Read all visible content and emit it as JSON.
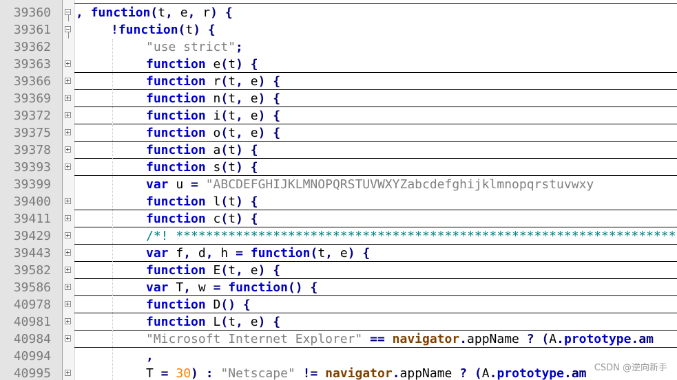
{
  "lines": [
    {
      "num": "39360",
      "fold": "minus",
      "indent": 0,
      "sep": false,
      "tokens": [
        {
          "t": "op",
          "v": ", "
        },
        {
          "t": "kw",
          "v": "function"
        },
        {
          "t": "op",
          "v": "("
        },
        {
          "t": "id",
          "v": "t"
        },
        {
          "t": "op",
          "v": ", "
        },
        {
          "t": "id",
          "v": "e"
        },
        {
          "t": "op",
          "v": ", "
        },
        {
          "t": "id",
          "v": "r"
        },
        {
          "t": "op",
          "v": ") {"
        }
      ]
    },
    {
      "num": "39361",
      "fold": "minus",
      "indent": 1,
      "sep": false,
      "tokens": [
        {
          "t": "op",
          "v": "!"
        },
        {
          "t": "kw",
          "v": "function"
        },
        {
          "t": "op",
          "v": "("
        },
        {
          "t": "id",
          "v": "t"
        },
        {
          "t": "op",
          "v": ") {"
        }
      ]
    },
    {
      "num": "39362",
      "fold": "none",
      "indent": 2,
      "sep": false,
      "tokens": [
        {
          "t": "str",
          "v": "\"use strict\""
        },
        {
          "t": "op",
          "v": ";"
        }
      ]
    },
    {
      "num": "39363",
      "fold": "plus",
      "indent": 2,
      "sep": true,
      "tokens": [
        {
          "t": "kw",
          "v": "function"
        },
        {
          "t": "op",
          "v": " "
        },
        {
          "t": "id",
          "v": "e"
        },
        {
          "t": "op",
          "v": "("
        },
        {
          "t": "id",
          "v": "t"
        },
        {
          "t": "op",
          "v": ") {"
        }
      ]
    },
    {
      "num": "39366",
      "fold": "plus",
      "indent": 2,
      "sep": true,
      "tokens": [
        {
          "t": "kw",
          "v": "function"
        },
        {
          "t": "op",
          "v": " "
        },
        {
          "t": "id",
          "v": "r"
        },
        {
          "t": "op",
          "v": "("
        },
        {
          "t": "id",
          "v": "t"
        },
        {
          "t": "op",
          "v": ", "
        },
        {
          "t": "id",
          "v": "e"
        },
        {
          "t": "op",
          "v": ") {"
        }
      ]
    },
    {
      "num": "39369",
      "fold": "plus",
      "indent": 2,
      "sep": true,
      "tokens": [
        {
          "t": "kw",
          "v": "function"
        },
        {
          "t": "op",
          "v": " "
        },
        {
          "t": "id",
          "v": "n"
        },
        {
          "t": "op",
          "v": "("
        },
        {
          "t": "id",
          "v": "t"
        },
        {
          "t": "op",
          "v": ", "
        },
        {
          "t": "id",
          "v": "e"
        },
        {
          "t": "op",
          "v": ") {"
        }
      ]
    },
    {
      "num": "39372",
      "fold": "plus",
      "indent": 2,
      "sep": true,
      "tokens": [
        {
          "t": "kw",
          "v": "function"
        },
        {
          "t": "op",
          "v": " "
        },
        {
          "t": "id",
          "v": "i"
        },
        {
          "t": "op",
          "v": "("
        },
        {
          "t": "id",
          "v": "t"
        },
        {
          "t": "op",
          "v": ", "
        },
        {
          "t": "id",
          "v": "e"
        },
        {
          "t": "op",
          "v": ") {"
        }
      ]
    },
    {
      "num": "39375",
      "fold": "plus",
      "indent": 2,
      "sep": true,
      "tokens": [
        {
          "t": "kw",
          "v": "function"
        },
        {
          "t": "op",
          "v": " "
        },
        {
          "t": "id",
          "v": "o"
        },
        {
          "t": "op",
          "v": "("
        },
        {
          "t": "id",
          "v": "t"
        },
        {
          "t": "op",
          "v": ", "
        },
        {
          "t": "id",
          "v": "e"
        },
        {
          "t": "op",
          "v": ") {"
        }
      ]
    },
    {
      "num": "39378",
      "fold": "plus",
      "indent": 2,
      "sep": true,
      "tokens": [
        {
          "t": "kw",
          "v": "function"
        },
        {
          "t": "op",
          "v": " "
        },
        {
          "t": "id",
          "v": "a"
        },
        {
          "t": "op",
          "v": "("
        },
        {
          "t": "id",
          "v": "t"
        },
        {
          "t": "op",
          "v": ") {"
        }
      ]
    },
    {
      "num": "39393",
      "fold": "plus",
      "indent": 2,
      "sep": true,
      "tokens": [
        {
          "t": "kw",
          "v": "function"
        },
        {
          "t": "op",
          "v": " "
        },
        {
          "t": "id",
          "v": "s"
        },
        {
          "t": "op",
          "v": "("
        },
        {
          "t": "id",
          "v": "t"
        },
        {
          "t": "op",
          "v": ") {"
        }
      ]
    },
    {
      "num": "39399",
      "fold": "none",
      "indent": 2,
      "sep": false,
      "tokens": [
        {
          "t": "kw",
          "v": "var"
        },
        {
          "t": "op",
          "v": " "
        },
        {
          "t": "id",
          "v": "u"
        },
        {
          "t": "op",
          "v": " = "
        },
        {
          "t": "str",
          "v": "\"ABCDEFGHIJKLMNOPQRSTUVWXYZabcdefghijklmnopqrstuvwxy"
        }
      ]
    },
    {
      "num": "39400",
      "fold": "plus",
      "indent": 2,
      "sep": true,
      "tokens": [
        {
          "t": "kw",
          "v": "function"
        },
        {
          "t": "op",
          "v": " "
        },
        {
          "t": "id",
          "v": "l"
        },
        {
          "t": "op",
          "v": "("
        },
        {
          "t": "id",
          "v": "t"
        },
        {
          "t": "op",
          "v": ") {"
        }
      ]
    },
    {
      "num": "39411",
      "fold": "plus",
      "indent": 2,
      "sep": true,
      "tokens": [
        {
          "t": "kw",
          "v": "function"
        },
        {
          "t": "op",
          "v": " "
        },
        {
          "t": "id",
          "v": "c"
        },
        {
          "t": "op",
          "v": "("
        },
        {
          "t": "id",
          "v": "t"
        },
        {
          "t": "op",
          "v": ") {"
        }
      ]
    },
    {
      "num": "39429",
      "fold": "plus",
      "indent": 2,
      "sep": true,
      "tokens": [
        {
          "t": "com",
          "v": "/*! ************************************************************************"
        }
      ]
    },
    {
      "num": "39443",
      "fold": "plus",
      "indent": 2,
      "sep": true,
      "tokens": [
        {
          "t": "kw",
          "v": "var"
        },
        {
          "t": "op",
          "v": " "
        },
        {
          "t": "id",
          "v": "f"
        },
        {
          "t": "op",
          "v": ", "
        },
        {
          "t": "id",
          "v": "d"
        },
        {
          "t": "op",
          "v": ", "
        },
        {
          "t": "id",
          "v": "h"
        },
        {
          "t": "op",
          "v": " = "
        },
        {
          "t": "kw",
          "v": "function"
        },
        {
          "t": "op",
          "v": "("
        },
        {
          "t": "id",
          "v": "t"
        },
        {
          "t": "op",
          "v": ", "
        },
        {
          "t": "id",
          "v": "e"
        },
        {
          "t": "op",
          "v": ") {"
        }
      ]
    },
    {
      "num": "39582",
      "fold": "plus",
      "indent": 2,
      "sep": true,
      "tokens": [
        {
          "t": "kw",
          "v": "function"
        },
        {
          "t": "op",
          "v": " "
        },
        {
          "t": "id",
          "v": "E"
        },
        {
          "t": "op",
          "v": "("
        },
        {
          "t": "id",
          "v": "t"
        },
        {
          "t": "op",
          "v": ", "
        },
        {
          "t": "id",
          "v": "e"
        },
        {
          "t": "op",
          "v": ") {"
        }
      ]
    },
    {
      "num": "39586",
      "fold": "plus",
      "indent": 2,
      "sep": true,
      "tokens": [
        {
          "t": "kw",
          "v": "var"
        },
        {
          "t": "op",
          "v": " "
        },
        {
          "t": "id",
          "v": "T"
        },
        {
          "t": "op",
          "v": ", "
        },
        {
          "t": "id",
          "v": "w"
        },
        {
          "t": "op",
          "v": " = "
        },
        {
          "t": "kw",
          "v": "function"
        },
        {
          "t": "op",
          "v": "() {"
        }
      ]
    },
    {
      "num": "40978",
      "fold": "plus",
      "indent": 2,
      "sep": true,
      "tokens": [
        {
          "t": "kw",
          "v": "function"
        },
        {
          "t": "op",
          "v": " "
        },
        {
          "t": "id",
          "v": "D"
        },
        {
          "t": "op",
          "v": "() {"
        }
      ]
    },
    {
      "num": "40981",
      "fold": "plus",
      "indent": 2,
      "sep": true,
      "tokens": [
        {
          "t": "kw",
          "v": "function"
        },
        {
          "t": "op",
          "v": " "
        },
        {
          "t": "id",
          "v": "L"
        },
        {
          "t": "op",
          "v": "("
        },
        {
          "t": "id",
          "v": "t"
        },
        {
          "t": "op",
          "v": ", "
        },
        {
          "t": "id",
          "v": "e"
        },
        {
          "t": "op",
          "v": ") {"
        }
      ]
    },
    {
      "num": "40984",
      "fold": "plus",
      "indent": 2,
      "sep": true,
      "tokens": [
        {
          "t": "str",
          "v": "\"Microsoft Internet Explorer\""
        },
        {
          "t": "op",
          "v": " == "
        },
        {
          "t": "glob",
          "v": "navigator"
        },
        {
          "t": "op",
          "v": "."
        },
        {
          "t": "id",
          "v": "appName"
        },
        {
          "t": "op",
          "v": " ? ("
        },
        {
          "t": "id",
          "v": "A"
        },
        {
          "t": "op",
          "v": "."
        },
        {
          "t": "prop",
          "v": "prototype"
        },
        {
          "t": "op",
          "v": ".am"
        }
      ]
    },
    {
      "num": "40994",
      "fold": "none",
      "indent": 2,
      "sep": false,
      "tokens": [
        {
          "t": "op",
          "v": ","
        }
      ]
    },
    {
      "num": "40995",
      "fold": "plus",
      "indent": 2,
      "sep": false,
      "tokens": [
        {
          "t": "id",
          "v": "T"
        },
        {
          "t": "op",
          "v": " = "
        },
        {
          "t": "num",
          "v": "30"
        },
        {
          "t": "op",
          "v": ") : "
        },
        {
          "t": "str",
          "v": "\"Netscape\""
        },
        {
          "t": "op",
          "v": " != "
        },
        {
          "t": "glob",
          "v": "navigator"
        },
        {
          "t": "op",
          "v": "."
        },
        {
          "t": "id",
          "v": "appName"
        },
        {
          "t": "op",
          "v": " ? ("
        },
        {
          "t": "id",
          "v": "A"
        },
        {
          "t": "op",
          "v": "."
        },
        {
          "t": "prop",
          "v": "prototype"
        },
        {
          "t": "op",
          "v": ".am"
        }
      ]
    }
  ],
  "watermark": "CSDN @逆向新手"
}
